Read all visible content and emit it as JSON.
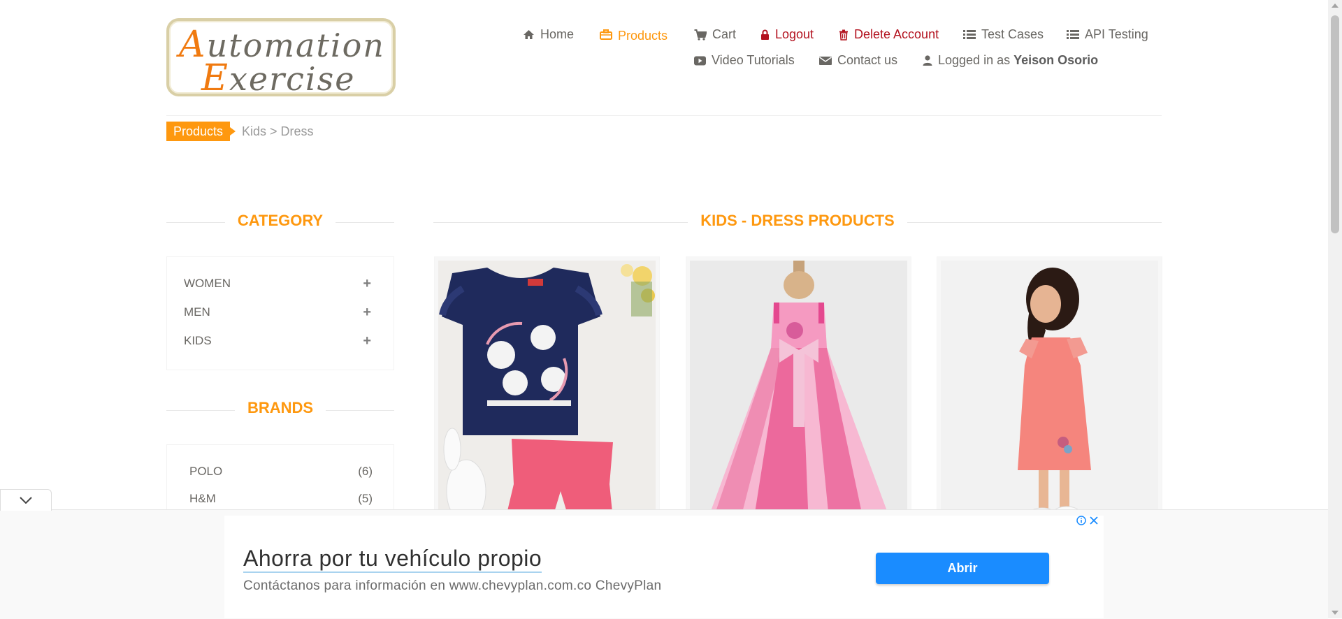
{
  "header": {
    "logo_line1_cap": "A",
    "logo_line1_rest": "utomation",
    "logo_line2_cap": "E",
    "logo_line2_rest": "xercise",
    "nav": {
      "home": "Home",
      "products": "Products",
      "cart": "Cart",
      "logout": "Logout",
      "delete_account": "Delete Account",
      "test_cases": "Test Cases",
      "api_testing": "API Testing",
      "video_tutorials": "Video Tutorials",
      "contact_us": "Contact us",
      "logged_in_prefix": "Logged in as",
      "logged_in_user": "Yeison Osorio"
    }
  },
  "breadcrumb": {
    "active": "Products",
    "path": "Kids > Dress"
  },
  "sidebar": {
    "category_title": "CATEGORY",
    "categories": [
      {
        "label": "WOMEN",
        "icon": "+"
      },
      {
        "label": "MEN",
        "icon": "+"
      },
      {
        "label": "KIDS",
        "icon": "+"
      }
    ],
    "brands_title": "BRANDS",
    "brands": [
      {
        "label": "POLO",
        "count": "(6)"
      },
      {
        "label": "H&M",
        "count": "(5)"
      }
    ]
  },
  "main": {
    "title": "KIDS - DRESS PRODUCTS"
  },
  "ad": {
    "title": "Ahorra por tu vehículo propio",
    "subtitle": "Contáctanos para información en www.chevyplan.com.co ChevyPlan",
    "button": "Abrir"
  },
  "colors": {
    "accent": "#fe980f",
    "danger": "#b3121f",
    "ad_button": "#1a8cff"
  }
}
